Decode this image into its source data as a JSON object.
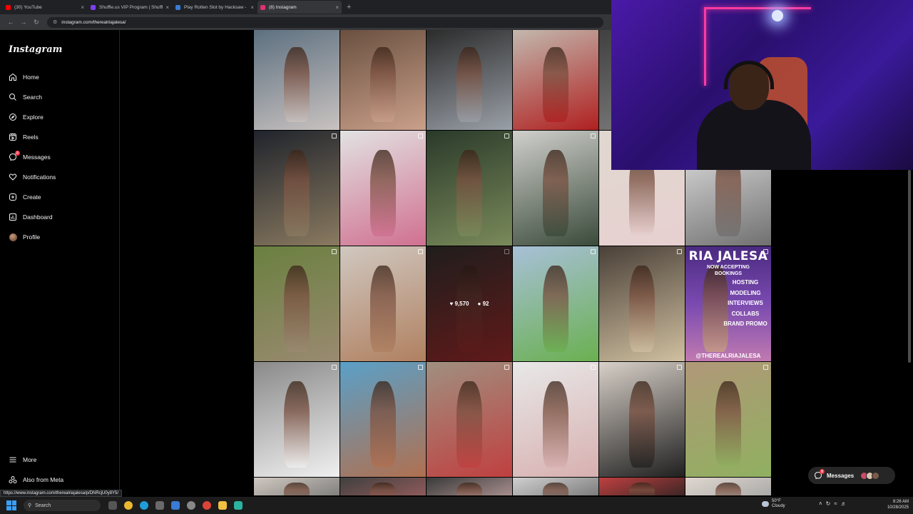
{
  "browser": {
    "tabs": [
      {
        "title": "(30) YouTube",
        "favicon_color": "#ff0000",
        "active": false
      },
      {
        "title": "Shuffle.us VIP Program | Shuffl…",
        "favicon_color": "#7b3ff2",
        "active": false
      },
      {
        "title": "Play Rotten Slot by Hacksaw - …",
        "favicon_color": "#3a7bd5",
        "active": false
      },
      {
        "title": "(8) Instagram",
        "favicon_color": "#e1306c",
        "active": true
      }
    ],
    "url": "instagram.com/therealriajalesa/",
    "new_tab_icon": "plus-icon"
  },
  "sidebar": {
    "logo": "Instagram",
    "items": [
      {
        "label": "Home",
        "icon": "home-icon"
      },
      {
        "label": "Search",
        "icon": "search-icon"
      },
      {
        "label": "Explore",
        "icon": "compass-icon"
      },
      {
        "label": "Reels",
        "icon": "reels-icon"
      },
      {
        "label": "Messages",
        "icon": "messenger-icon",
        "badge": "8"
      },
      {
        "label": "Notifications",
        "icon": "heart-icon"
      },
      {
        "label": "Create",
        "icon": "plus-square-icon"
      },
      {
        "label": "Dashboard",
        "icon": "dashboard-icon"
      },
      {
        "label": "Profile",
        "icon": "avatar"
      }
    ],
    "bottom": [
      {
        "label": "More",
        "icon": "hamburger-icon"
      },
      {
        "label": "Also from Meta",
        "icon": "meta-icon"
      }
    ]
  },
  "grid": {
    "hover_post": {
      "likes": "9,570",
      "comments": "92"
    },
    "promo": {
      "title": "RIA JALESA",
      "subtitle_1": "NOW ACCEPTING",
      "subtitle_2": "BOOKINGS",
      "services": [
        "HOSTING",
        "MODELING",
        "INTERVIEWS",
        "COLLABS",
        "BRAND PROMO"
      ],
      "handle": "@THEREALRIAJALESA"
    }
  },
  "messages_pill": {
    "label": "Messages",
    "badge": "8"
  },
  "status_url": "https://www.instagram.com/therealriajalesa/p/DNRcjU0y8Y5/",
  "taskbar": {
    "search_label": "Search",
    "weather_temp": "50°F",
    "weather_desc": "Cloudy",
    "time": "8:26 AM",
    "date": "10/28/2025"
  }
}
